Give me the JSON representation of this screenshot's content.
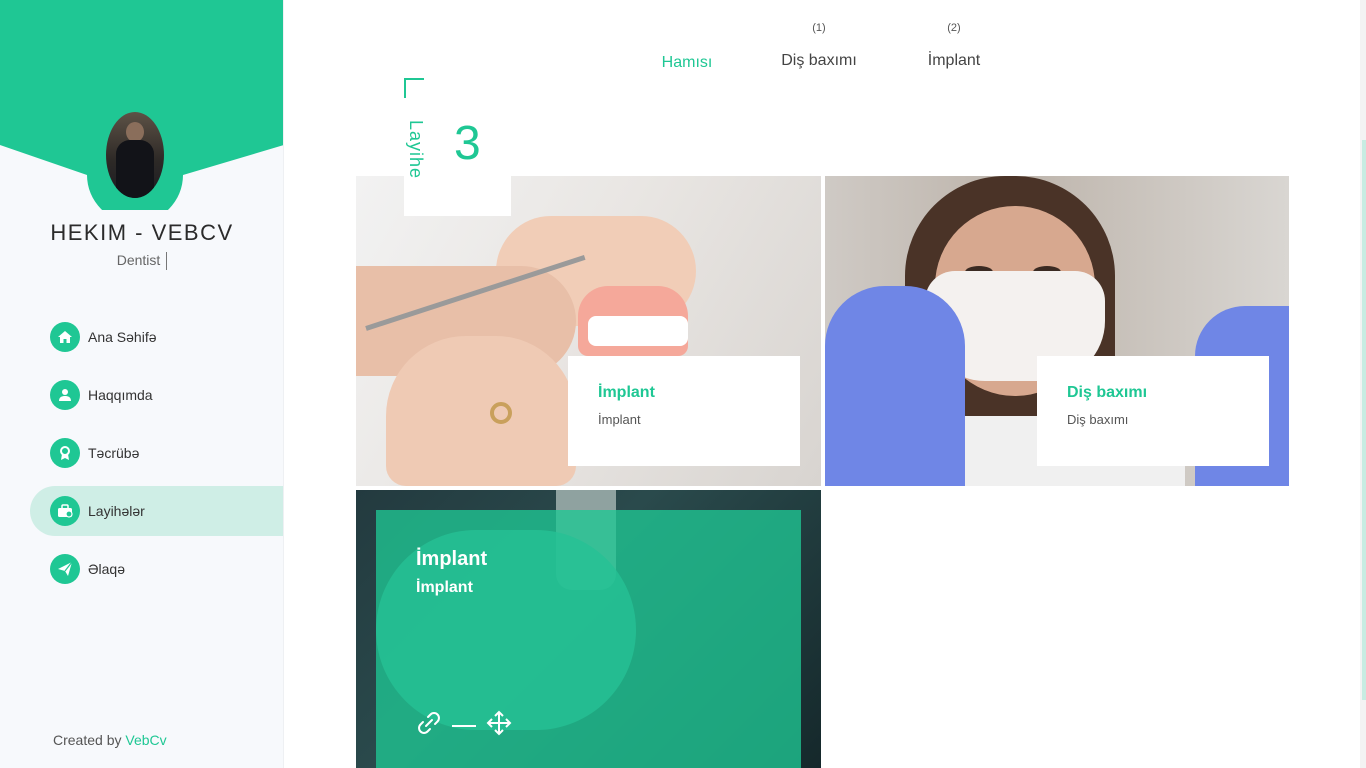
{
  "sidebar": {
    "title": "HEKIM - VEBCV",
    "subtitle": "Dentist",
    "accent": "#1fc794",
    "nav": [
      {
        "label": "Ana Səhifə",
        "icon": "home-icon"
      },
      {
        "label": "Haqqımda",
        "icon": "user-icon"
      },
      {
        "label": "Təcrübə",
        "icon": "award-icon"
      },
      {
        "label": "Layihələr",
        "icon": "briefcase-icon",
        "active": true
      },
      {
        "label": "Əlaqə",
        "icon": "send-icon"
      }
    ],
    "credit_prefix": "Created by",
    "credit_brand": "VebCv"
  },
  "filters": {
    "items": [
      {
        "label": "Hamısı",
        "count": "",
        "active": true
      },
      {
        "label": "Diş baxımı",
        "count": "(1)"
      },
      {
        "label": "İmplant",
        "count": "(2)"
      }
    ]
  },
  "projects_counter": {
    "label": "Layihe",
    "number": "3"
  },
  "projects": [
    {
      "title": "İmplant",
      "category": "İmplant"
    },
    {
      "title": "Diş baxımı",
      "category": "Diş baxımı"
    },
    {
      "title": "İmplant",
      "category": "İmplant",
      "actions": [
        "link-icon",
        "move-icon"
      ]
    }
  ]
}
